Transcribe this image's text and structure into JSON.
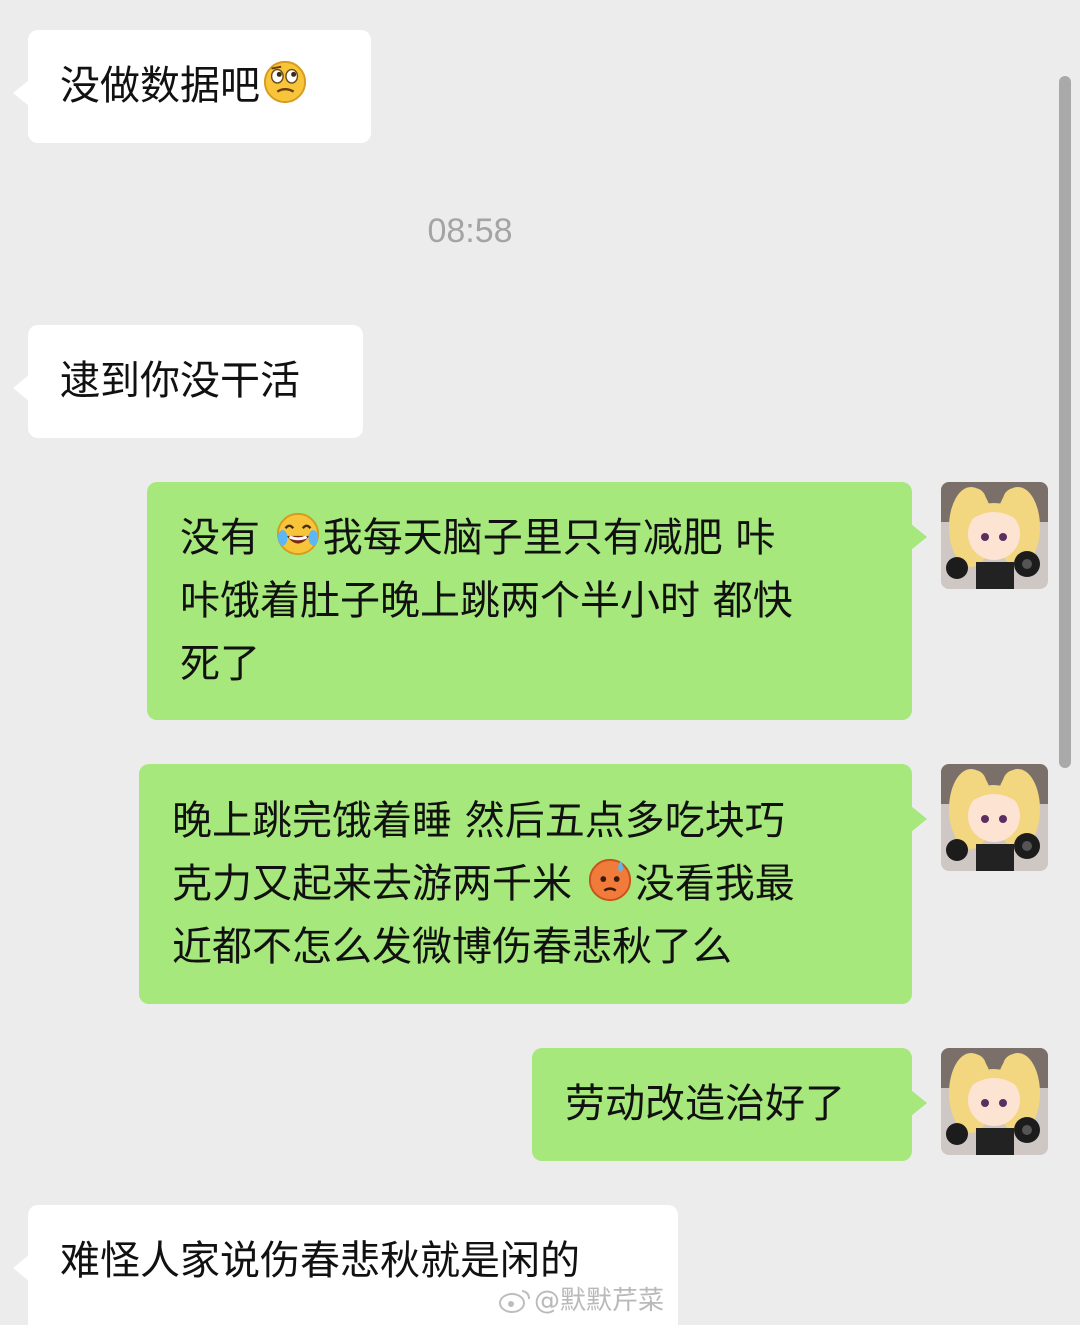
{
  "chat": {
    "timestamp": "08:58",
    "messages": [
      {
        "side": "in",
        "lines": [
          "没做数据吧"
        ],
        "emoji_after": "thinking-face"
      },
      {
        "side": "in",
        "lines": [
          "逮到你没干活"
        ]
      },
      {
        "side": "out",
        "line1_before_emoji": "没有 ",
        "line1_emoji": "laughing-tears-face",
        "line1_after_emoji": "我每天脑子里只有减肥  咔",
        "line2": "咔饿着肚子晚上跳两个半小时  都快",
        "line3": "死了"
      },
      {
        "side": "out",
        "line1": "晚上跳完饿着睡  然后五点多吃块巧",
        "line2_before_emoji": "克力又起来去游两千米  ",
        "line2_emoji": "anxious-sweat-face",
        "line2_after_emoji": "没看我最",
        "line3": "近都不怎么发微博伤春悲秋了么"
      },
      {
        "side": "out",
        "lines": [
          "劳动改造治好了"
        ]
      },
      {
        "side": "in",
        "lines": [
          "难怪人家说伤春悲秋就是闲的"
        ]
      }
    ]
  },
  "watermark": "@默默芹菜",
  "colors": {
    "background": "#ececec",
    "incoming_bubble": "#ffffff",
    "outgoing_bubble": "#a6e87b",
    "timestamp_text": "#a4a4a4"
  }
}
